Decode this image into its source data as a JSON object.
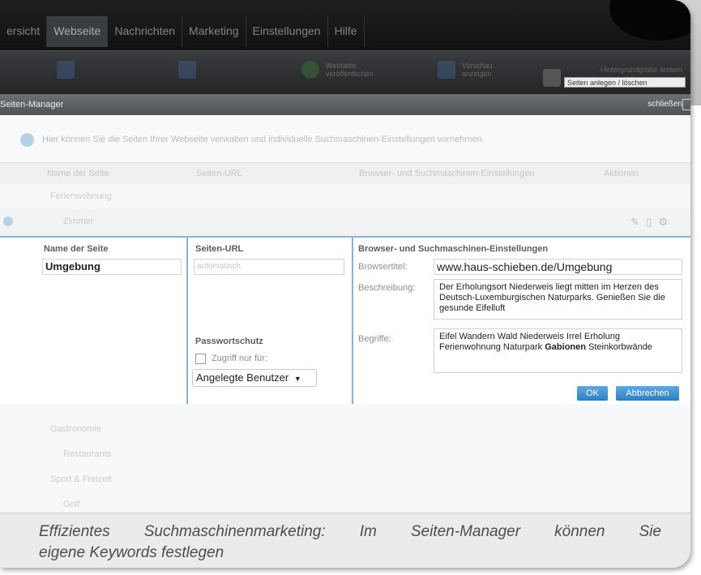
{
  "nav": {
    "tabs": [
      "ersicht",
      "Webseite",
      "Nachrichten",
      "Marketing",
      "Einstellungen",
      "Hilfe"
    ]
  },
  "toolbar": {
    "items": [
      "Webseite veröffentlichen",
      "Vorschau anzeigen"
    ],
    "select_label": "Hintergrundgröße ändern",
    "select_value": "Seiten anlegen / löschen"
  },
  "seiten_manager": {
    "title": "Seiten-Manager",
    "close_label": "schließen",
    "info_text": "Hier können Sie die Seiten Ihrer Webseite verwalten und individuelle Suchmaschinen-Einstellungen vornehmen."
  },
  "table": {
    "headers": [
      "Name der Seite",
      "Seiten-URL",
      "Browser- und Suchmaschinen-Einstellungen",
      "Aktionen"
    ],
    "rows_top": [
      "Ferienwohnung",
      "Zimmer"
    ],
    "rows_bottom": [
      "Gastronomie",
      "Restaurants",
      "Sport & Freizeit",
      "Golf"
    ]
  },
  "edit_panel": {
    "name_header": "Name der Seite",
    "name_value": "Umgebung",
    "url_header": "Seiten-URL",
    "url_placeholder": "automatisch",
    "password_label": "Passwortschutz",
    "access_label": "Zugriff nur für:",
    "access_select": "Angelegte Benutzer",
    "seo_header": "Browser- und Suchmaschinen-Einstellungen",
    "browser_title_label": "Browsertitel:",
    "browser_title_value": "www.haus-schieben.de/Umgebung",
    "description_label": "Beschreibung:",
    "description_value": "Der Erholungsort Niederweis liegt mitten im Herzen des Deutsch-Luxemburgischen Naturparks. Genießen Sie die gesunde Eifelluft",
    "keywords_label": "Begriffe:",
    "keywords_value": "Eifel Wandern Wald Niederweis Irrel Erholung Ferienwohnung Naturpark ",
    "keywords_bold": "Gabionen",
    "keywords_tail": " Steinkorbwände",
    "ok_label": "OK",
    "cancel_label": "Abbrechen"
  },
  "caption": {
    "line1": "Effizientes Suchmaschinenmarketing: Im Seiten-Manager können Sie",
    "line2": "eigene Keywords festlegen"
  },
  "colors": {
    "accent_blue": "#2b7fc4",
    "panel_border": "#86b3d8",
    "nav_dark": "#111111"
  }
}
